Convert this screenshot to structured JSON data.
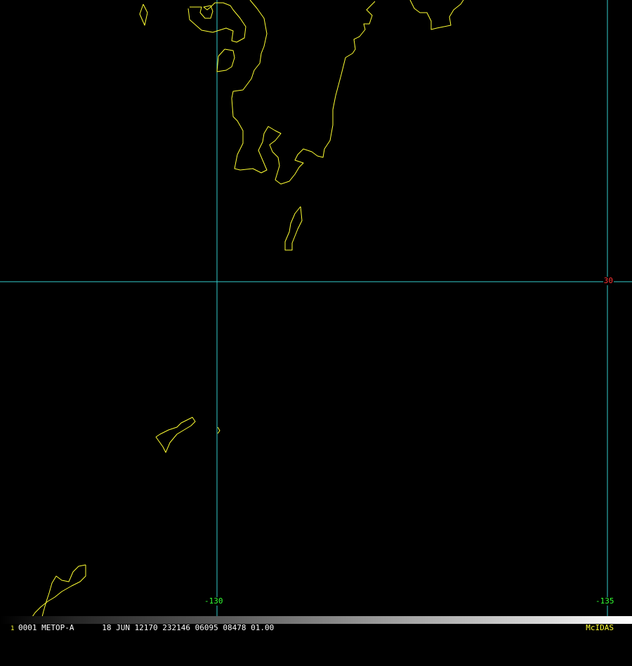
{
  "colors": {
    "background": "#000000",
    "grid": "#33cccc",
    "coast": "#ffff33",
    "lat_label": "#ff3333",
    "lon_label": "#33ff33",
    "info_text": "#ffffff",
    "frame_number": "#ffff33",
    "brand": "#ffff33"
  },
  "map": {
    "latitude_labels": [
      "30"
    ],
    "longitude_labels": [
      "-130",
      "-135"
    ]
  },
  "status_bar": {
    "frame_number": "1",
    "image_info": "0001 METOP-A      18 JUN 12170 232146 06095 08478 01.00",
    "brand": "McIDAS"
  }
}
